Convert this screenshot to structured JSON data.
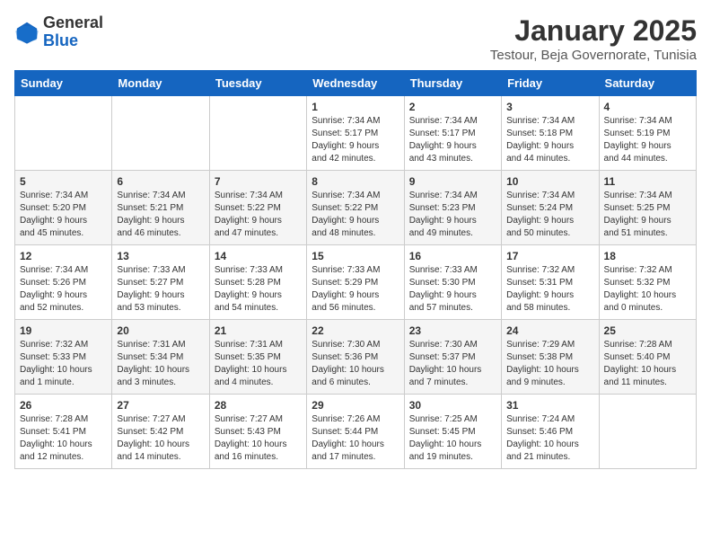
{
  "logo": {
    "general": "General",
    "blue": "Blue"
  },
  "title": "January 2025",
  "subtitle": "Testour, Beja Governorate, Tunisia",
  "days_of_week": [
    "Sunday",
    "Monday",
    "Tuesday",
    "Wednesday",
    "Thursday",
    "Friday",
    "Saturday"
  ],
  "weeks": [
    [
      {
        "day": "",
        "info": ""
      },
      {
        "day": "",
        "info": ""
      },
      {
        "day": "",
        "info": ""
      },
      {
        "day": "1",
        "info": "Sunrise: 7:34 AM\nSunset: 5:17 PM\nDaylight: 9 hours\nand 42 minutes."
      },
      {
        "day": "2",
        "info": "Sunrise: 7:34 AM\nSunset: 5:17 PM\nDaylight: 9 hours\nand 43 minutes."
      },
      {
        "day": "3",
        "info": "Sunrise: 7:34 AM\nSunset: 5:18 PM\nDaylight: 9 hours\nand 44 minutes."
      },
      {
        "day": "4",
        "info": "Sunrise: 7:34 AM\nSunset: 5:19 PM\nDaylight: 9 hours\nand 44 minutes."
      }
    ],
    [
      {
        "day": "5",
        "info": "Sunrise: 7:34 AM\nSunset: 5:20 PM\nDaylight: 9 hours\nand 45 minutes."
      },
      {
        "day": "6",
        "info": "Sunrise: 7:34 AM\nSunset: 5:21 PM\nDaylight: 9 hours\nand 46 minutes."
      },
      {
        "day": "7",
        "info": "Sunrise: 7:34 AM\nSunset: 5:22 PM\nDaylight: 9 hours\nand 47 minutes."
      },
      {
        "day": "8",
        "info": "Sunrise: 7:34 AM\nSunset: 5:22 PM\nDaylight: 9 hours\nand 48 minutes."
      },
      {
        "day": "9",
        "info": "Sunrise: 7:34 AM\nSunset: 5:23 PM\nDaylight: 9 hours\nand 49 minutes."
      },
      {
        "day": "10",
        "info": "Sunrise: 7:34 AM\nSunset: 5:24 PM\nDaylight: 9 hours\nand 50 minutes."
      },
      {
        "day": "11",
        "info": "Sunrise: 7:34 AM\nSunset: 5:25 PM\nDaylight: 9 hours\nand 51 minutes."
      }
    ],
    [
      {
        "day": "12",
        "info": "Sunrise: 7:34 AM\nSunset: 5:26 PM\nDaylight: 9 hours\nand 52 minutes."
      },
      {
        "day": "13",
        "info": "Sunrise: 7:33 AM\nSunset: 5:27 PM\nDaylight: 9 hours\nand 53 minutes."
      },
      {
        "day": "14",
        "info": "Sunrise: 7:33 AM\nSunset: 5:28 PM\nDaylight: 9 hours\nand 54 minutes."
      },
      {
        "day": "15",
        "info": "Sunrise: 7:33 AM\nSunset: 5:29 PM\nDaylight: 9 hours\nand 56 minutes."
      },
      {
        "day": "16",
        "info": "Sunrise: 7:33 AM\nSunset: 5:30 PM\nDaylight: 9 hours\nand 57 minutes."
      },
      {
        "day": "17",
        "info": "Sunrise: 7:32 AM\nSunset: 5:31 PM\nDaylight: 9 hours\nand 58 minutes."
      },
      {
        "day": "18",
        "info": "Sunrise: 7:32 AM\nSunset: 5:32 PM\nDaylight: 10 hours\nand 0 minutes."
      }
    ],
    [
      {
        "day": "19",
        "info": "Sunrise: 7:32 AM\nSunset: 5:33 PM\nDaylight: 10 hours\nand 1 minute."
      },
      {
        "day": "20",
        "info": "Sunrise: 7:31 AM\nSunset: 5:34 PM\nDaylight: 10 hours\nand 3 minutes."
      },
      {
        "day": "21",
        "info": "Sunrise: 7:31 AM\nSunset: 5:35 PM\nDaylight: 10 hours\nand 4 minutes."
      },
      {
        "day": "22",
        "info": "Sunrise: 7:30 AM\nSunset: 5:36 PM\nDaylight: 10 hours\nand 6 minutes."
      },
      {
        "day": "23",
        "info": "Sunrise: 7:30 AM\nSunset: 5:37 PM\nDaylight: 10 hours\nand 7 minutes."
      },
      {
        "day": "24",
        "info": "Sunrise: 7:29 AM\nSunset: 5:38 PM\nDaylight: 10 hours\nand 9 minutes."
      },
      {
        "day": "25",
        "info": "Sunrise: 7:28 AM\nSunset: 5:40 PM\nDaylight: 10 hours\nand 11 minutes."
      }
    ],
    [
      {
        "day": "26",
        "info": "Sunrise: 7:28 AM\nSunset: 5:41 PM\nDaylight: 10 hours\nand 12 minutes."
      },
      {
        "day": "27",
        "info": "Sunrise: 7:27 AM\nSunset: 5:42 PM\nDaylight: 10 hours\nand 14 minutes."
      },
      {
        "day": "28",
        "info": "Sunrise: 7:27 AM\nSunset: 5:43 PM\nDaylight: 10 hours\nand 16 minutes."
      },
      {
        "day": "29",
        "info": "Sunrise: 7:26 AM\nSunset: 5:44 PM\nDaylight: 10 hours\nand 17 minutes."
      },
      {
        "day": "30",
        "info": "Sunrise: 7:25 AM\nSunset: 5:45 PM\nDaylight: 10 hours\nand 19 minutes."
      },
      {
        "day": "31",
        "info": "Sunrise: 7:24 AM\nSunset: 5:46 PM\nDaylight: 10 hours\nand 21 minutes."
      },
      {
        "day": "",
        "info": ""
      }
    ]
  ]
}
